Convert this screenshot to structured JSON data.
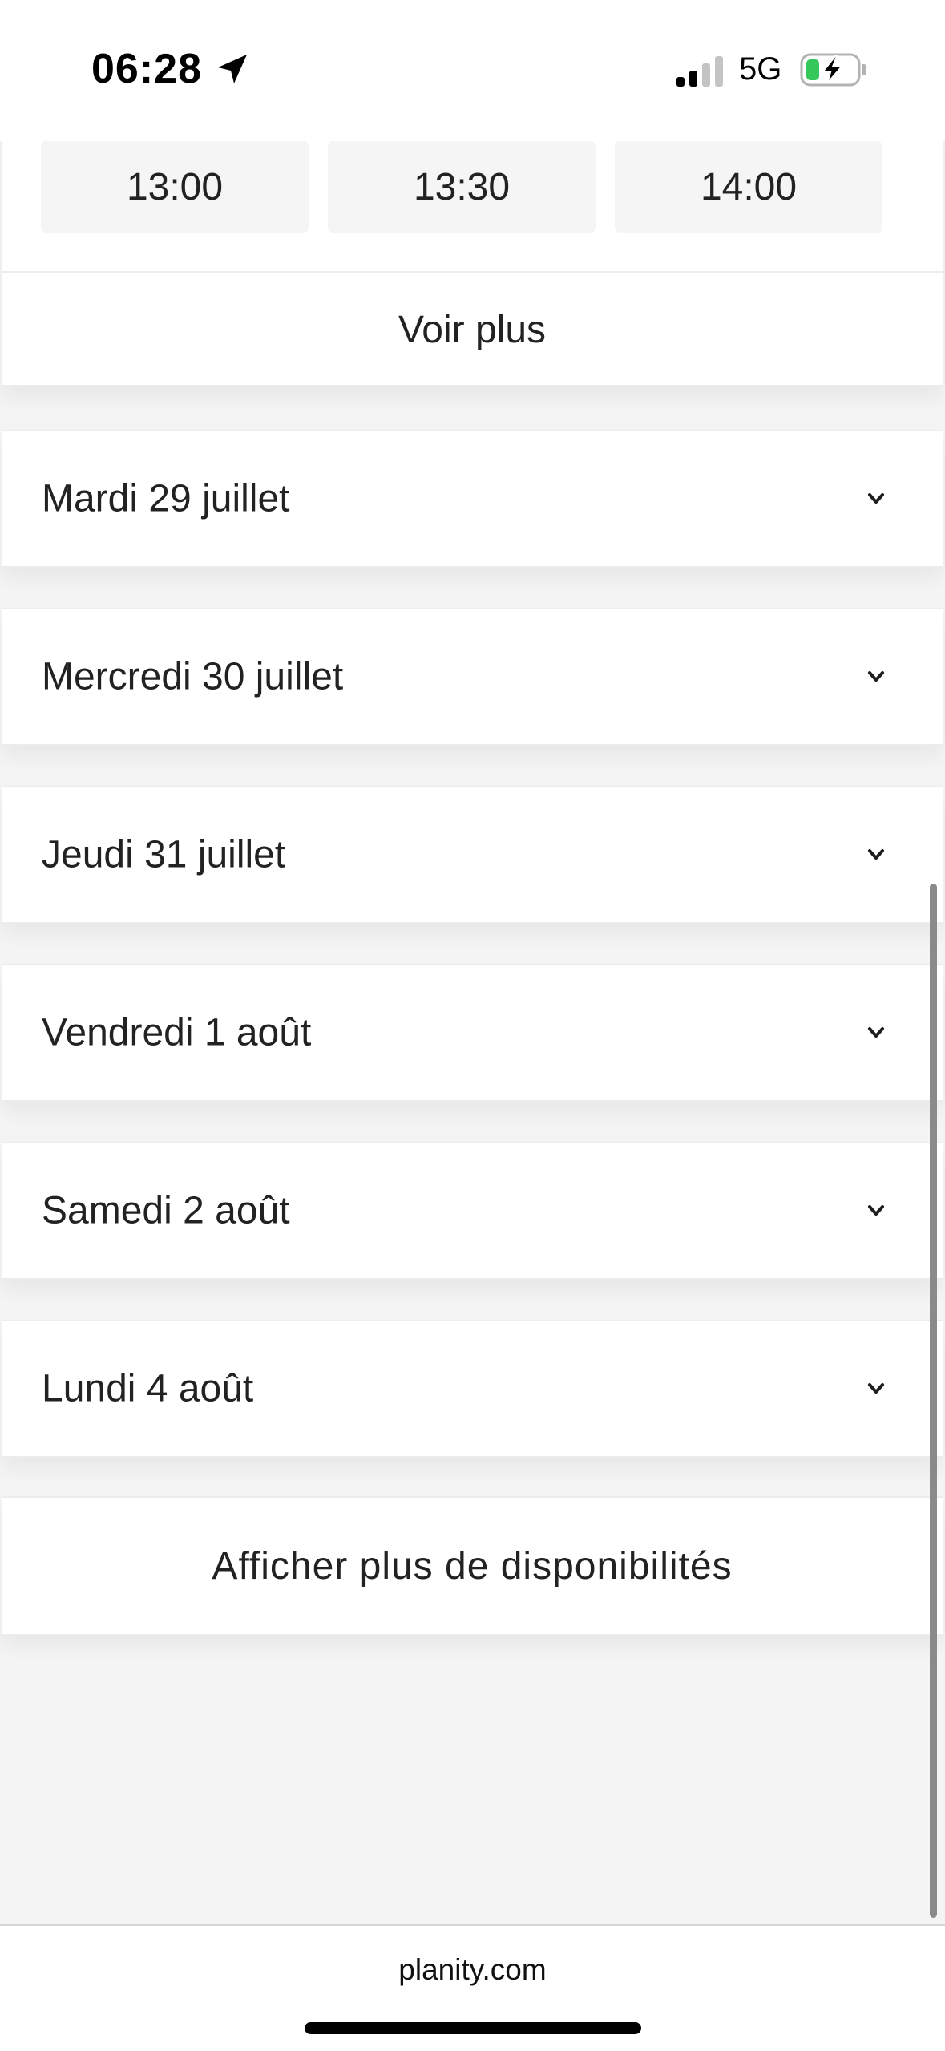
{
  "status_bar": {
    "time": "06:28",
    "network": "5G",
    "icons": [
      "location-arrow-icon",
      "signal-icon",
      "battery-charging-icon"
    ],
    "battery_color": "#34c759"
  },
  "time_slots": [
    "13:00",
    "13:30",
    "14:00"
  ],
  "see_more_label": "Voir plus",
  "days": [
    "Mardi 29 juillet",
    "Mercredi 30 juillet",
    "Jeudi 31 juillet",
    "Vendredi 1 août",
    "Samedi 2 août",
    "Lundi 4 août"
  ],
  "more_availability_label": "Afficher plus de disponibilités",
  "browser": {
    "url": "planity.com"
  }
}
